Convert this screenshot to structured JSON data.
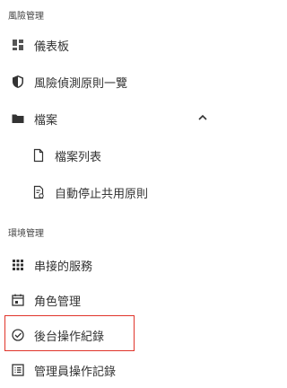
{
  "sections": {
    "risk": {
      "title": "風險管理"
    },
    "env": {
      "title": "環境管理"
    }
  },
  "items": {
    "dashboard": {
      "label": "儀表板",
      "icon": "dashboard-icon"
    },
    "risk_rules": {
      "label": "風險偵測原則一覽",
      "icon": "shield-icon"
    },
    "files": {
      "label": "檔案",
      "icon": "folder-icon",
      "expanded": true
    },
    "file_list": {
      "label": "檔案列表",
      "icon": "file-icon"
    },
    "auto_stop": {
      "label": "自動停止共用原則",
      "icon": "file-policy-icon"
    },
    "connected_services": {
      "label": "串接的服務",
      "icon": "grid-icon"
    },
    "role_mgmt": {
      "label": "角色管理",
      "icon": "calendar-icon"
    },
    "backend_logs": {
      "label": "後台操作紀錄",
      "icon": "check-circle-icon"
    },
    "admin_logs": {
      "label": "管理員操作記錄",
      "icon": "list-icon"
    }
  },
  "colors": {
    "highlight": "#e0342a",
    "text": "#333333"
  }
}
